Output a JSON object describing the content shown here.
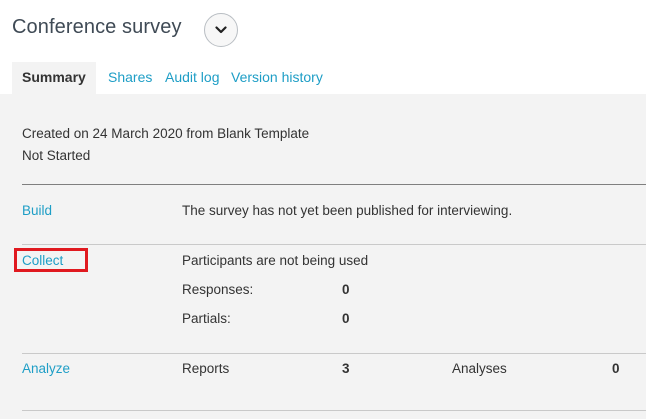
{
  "header": {
    "title": "Conference survey",
    "menu_icon": "chevron-down-icon"
  },
  "tabs": [
    {
      "label": "Summary",
      "active": true
    },
    {
      "label": "Shares",
      "active": false
    },
    {
      "label": "Audit log",
      "active": false
    },
    {
      "label": "Version history",
      "active": false
    }
  ],
  "summary": {
    "created": "Created on 24 March 2020 from Blank Template",
    "status": "Not Started"
  },
  "build": {
    "label": "Build",
    "message": "The survey has not yet been published for interviewing."
  },
  "collect": {
    "label": "Collect",
    "message": "Participants are not being used",
    "responses_label": "Responses:",
    "responses_value": "0",
    "partials_label": "Partials:",
    "partials_value": "0",
    "highlight_color": "#e0191f"
  },
  "analyze": {
    "label": "Analyze",
    "reports_label": "Reports",
    "reports_value": "3",
    "analyses_label": "Analyses",
    "analyses_value": "0"
  },
  "colors": {
    "link": "#1e9ec6",
    "panel_bg": "#f3f3f3",
    "title": "#3f4a55"
  }
}
